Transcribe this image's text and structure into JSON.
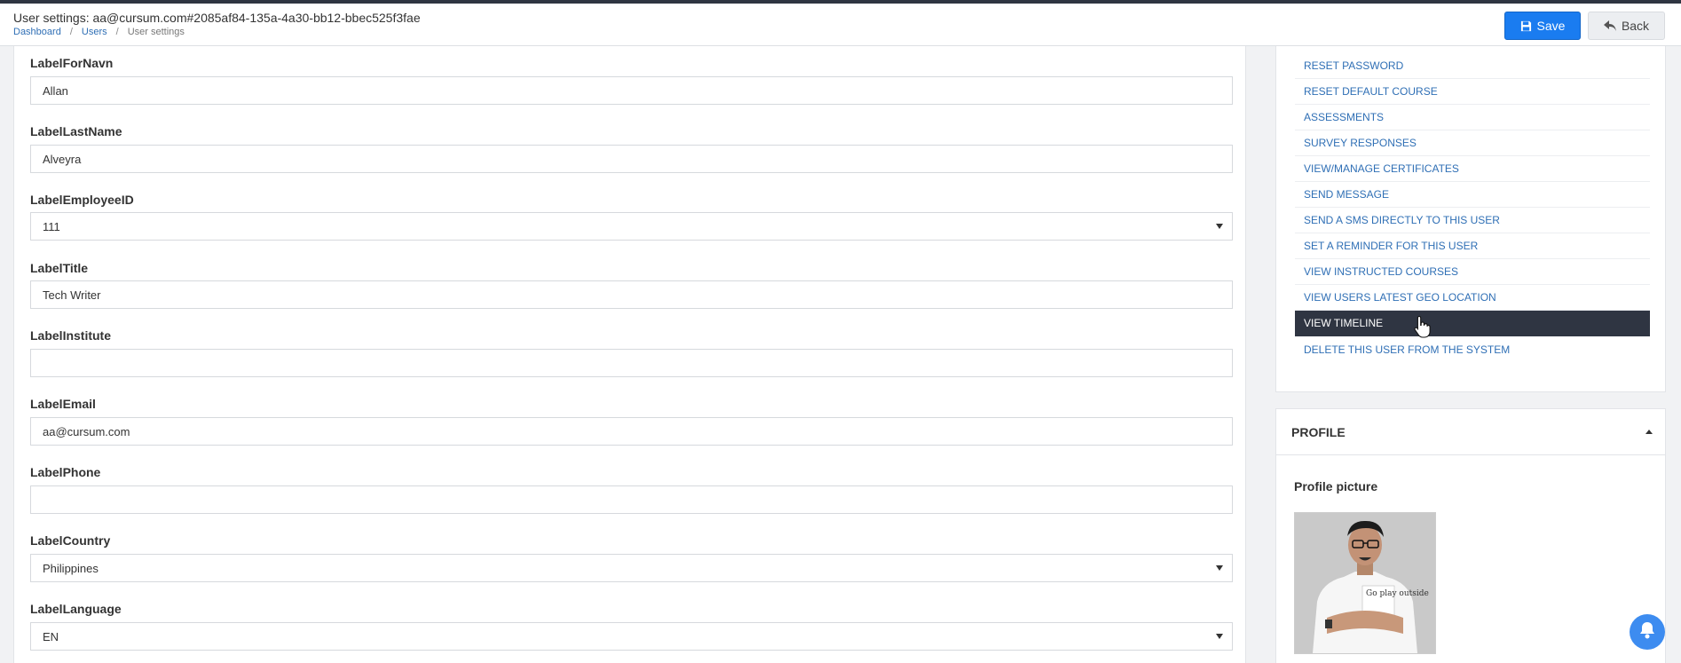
{
  "header": {
    "title": "User settings: aa@cursum.com#2085af84-135a-4a30-bb12-bbec525f3fae",
    "breadcrumb": [
      "Dashboard",
      "Users",
      "User settings"
    ],
    "save_label": "Save",
    "back_label": "Back"
  },
  "form": {
    "fields": [
      {
        "label": "LabelForNavn",
        "value": "Allan",
        "type": "text"
      },
      {
        "label": "LabelLastName",
        "value": "Alveyra",
        "type": "text"
      },
      {
        "label": "LabelEmployeeID",
        "value": "111",
        "type": "select"
      },
      {
        "label": "LabelTitle",
        "value": "Tech Writer",
        "type": "text"
      },
      {
        "label": "LabelInstitute",
        "value": "",
        "type": "text"
      },
      {
        "label": "LabelEmail",
        "value": "aa@cursum.com",
        "type": "text"
      },
      {
        "label": "LabelPhone",
        "value": "",
        "type": "text"
      },
      {
        "label": "LabelCountry",
        "value": "Philippines",
        "type": "select"
      },
      {
        "label": "LabelLanguage",
        "value": "EN",
        "type": "select"
      }
    ]
  },
  "actions": {
    "items": [
      "RESET PASSWORD",
      "RESET DEFAULT COURSE",
      "ASSESSMENTS",
      "SURVEY RESPONSES",
      "VIEW/MANAGE CERTIFICATES",
      "SEND MESSAGE",
      "SEND A SMS DIRECTLY TO THIS USER",
      "SET A REMINDER FOR THIS USER",
      "VIEW INSTRUCTED COURSES",
      "VIEW USERS LATEST GEO LOCATION",
      "VIEW TIMELINE",
      "DELETE THIS USER FROM THE SYSTEM"
    ],
    "active": "VIEW TIMELINE"
  },
  "profile": {
    "header": "PROFILE",
    "picture_label": "Profile picture",
    "shirt_text": "Go play outside"
  },
  "colors": {
    "accent": "#1a7cf0",
    "link": "#2f6fb5",
    "active_bg": "#2f3542",
    "notification": "#3d8cf0"
  },
  "icons": {
    "save": "floppy-disk-icon",
    "back": "reply-arrow-icon",
    "notification": "bell-icon"
  }
}
